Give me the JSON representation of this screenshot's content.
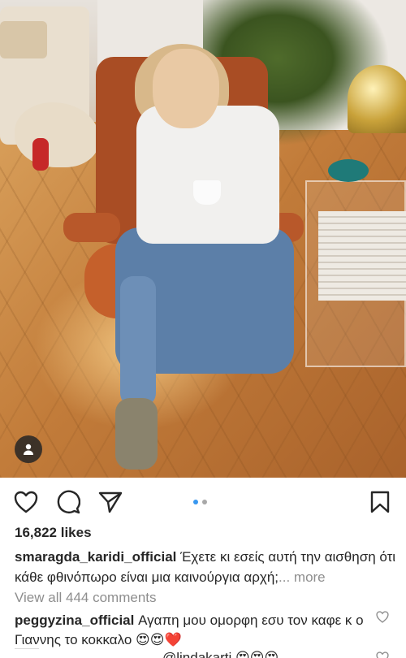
{
  "post": {
    "likes": "16,822 likes",
    "caption_user": "smaragda_karidi_official",
    "caption_text": " Έχετε κι εσείς αυτή την αισθηση ότι κάθε φθινόπωρο είναι μια καινούργια αρχή;",
    "caption_more": "... more",
    "view_comments": "View all 444 comments",
    "comment_user": "peggyzina_official",
    "comment_text": " Αγαπη μου ομορφη εσυ τον καφε κ ο Γιαννης το κοκκαλο 😍😍❤️",
    "comment2_text": "@lindakarti 😍😍😍"
  },
  "carousel": {
    "slides": 2,
    "active": 1
  },
  "icons": {
    "like": "heart-icon",
    "comment": "comment-bubble-icon",
    "share": "paper-plane-icon",
    "save": "bookmark-icon",
    "user_tag": "person-icon",
    "comment_like": "small-heart-icon"
  },
  "colors": {
    "text": "#262626",
    "muted": "#8e8e8e",
    "accent": "#3897f0"
  }
}
